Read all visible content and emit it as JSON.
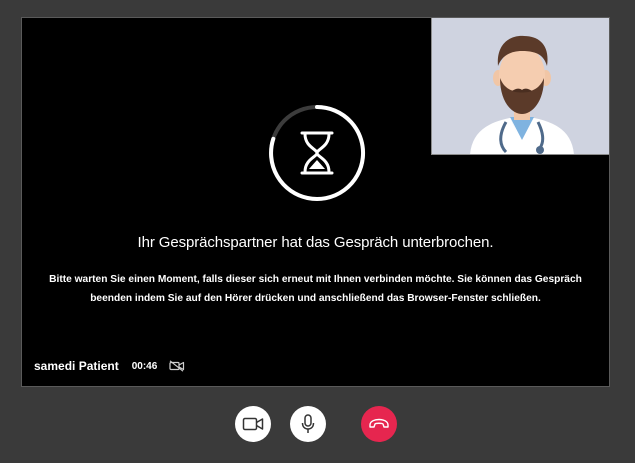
{
  "call": {
    "status_title": "Ihr Gesprächspartner hat das Gespräch unterbrochen.",
    "status_message_line1": "Bitte warten Sie einen Moment, falls dieser sich erneut mit Ihnen verbinden möchte. Sie können das Gespräch",
    "status_message_line2": "beenden indem Sie auf den Hörer drücken und anschließend das Browser-Fenster schließen.",
    "participant_name": "samedi Patient",
    "elapsed_time": "00:46",
    "local_camera_state": "camera-off-icon",
    "remote_avatar": "doctor-avatar",
    "waiting_icon": "hourglass-icon"
  },
  "controls": {
    "camera_button": "camera-icon",
    "microphone_button": "microphone-icon",
    "hangup_button": "phone-hangup-icon"
  },
  "colors": {
    "background": "#3a3a3a",
    "stage": "#000000",
    "pip_background": "#cfd3e0",
    "hangup": "#e6264f"
  }
}
